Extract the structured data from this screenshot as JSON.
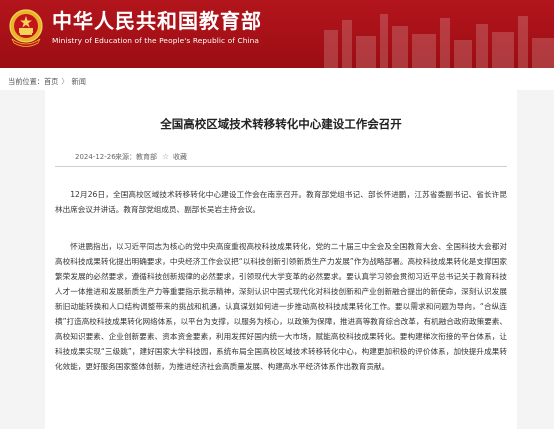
{
  "header": {
    "ministry_name_cn": "中华人民共和国教育部",
    "ministry_name_en": "Ministry of Education of the People's Republic of China",
    "brand_color": "#a8121a"
  },
  "breadcrumb": {
    "prefix": "当前位置：",
    "items": [
      "首页",
      "新闻"
    ],
    "separator": "〉"
  },
  "article": {
    "title": "全国高校区域技术转移转化中心建设工作会召开",
    "date": "2024-12-26",
    "source": "来源：教育部",
    "favorite_label": "收藏",
    "paragraphs": [
      "12月26日，全国高校区域技术转移转化中心建设工作会在南京召开。教育部党组书记、部长怀进鹏，江苏省委副书记、省长许昆林出席会议并讲话。教育部党组成员、副部长吴岩主持会议。",
      "怀进鹏指出，以习近平同志为核心的党中央高度重视高校科技成果转化，党的二十届三中全会及全国教育大会、全国科技大会都对高校科技成果转化提出明确要求，中央经济工作会议把“以科技创新引领新质生产力发展”作为战略部署。高校科技成果转化是支撑国家繁荣发展的必然要求，遵循科技创新规律的必然要求，引领现代大学变革的必然要求。要认真学习领会贯彻习近平总书记关于教育科技人才一体推进和发展新质生产力等重要指示批示精神，深刻认识中国式现代化对科技创新和产业创新融合提出的新使命，深刻认识发展新旧动能转换和人口结构调整带来的挑战和机遇，认真谋划如何进一步推动高校科技成果转化工作。要以需求和问题为导向，“合纵连横”打造高校科技成果转化网络体系，以平台为支撑，以服务为核心，以政策为保障，推进高等教育综合改革，有机融合政府政策要素、高校知识要素、企业创新要素、资本资金要素，利用发挥好国内统一大市场，赋能高校科技成果转化。要构建梯次衔接的平台体系，让科技成果实现“三级跳”，建好国家大学科技园，系统布局全国高校区域技术转移转化中心，构建更加积极的评价体系，加快提升成果转化效能，更好服务国家整体创新，为推进经济社会高质量发展、构建高水平经济体系作出教育贡献。"
    ]
  }
}
